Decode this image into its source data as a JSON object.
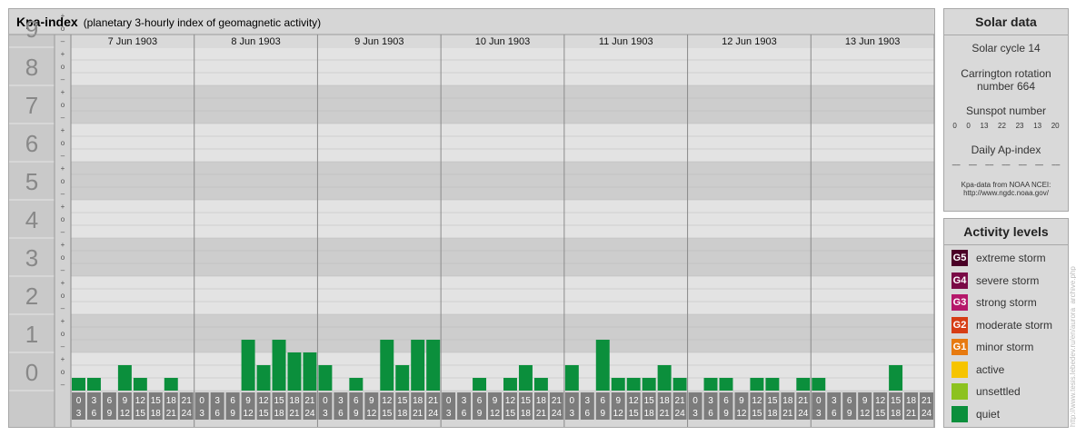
{
  "header": {
    "title": "Kpa-index",
    "subtitle": "(planetary 3-hourly index of geomagnetic activity)"
  },
  "chart_data": {
    "type": "bar",
    "ylim": [
      0,
      9
    ],
    "y_ticks": [
      "0",
      "1",
      "2",
      "3",
      "4",
      "5",
      "6",
      "7",
      "8",
      "9"
    ],
    "sub_ticks": [
      "+",
      "o",
      "–"
    ],
    "days": [
      "7 Jun 1903",
      "8 Jun 1903",
      "9 Jun 1903",
      "10 Jun 1903",
      "11 Jun 1903",
      "12 Jun 1903",
      "13 Jun 1903"
    ],
    "hour_start_labels": [
      "0",
      "3",
      "6",
      "9",
      "12",
      "15",
      "18",
      "21"
    ],
    "hour_end_labels": [
      "3",
      "6",
      "9",
      "12",
      "15",
      "18",
      "21",
      "24"
    ],
    "values": [
      [
        0.333,
        0.333,
        0,
        0.667,
        0.333,
        0,
        0.333,
        0
      ],
      [
        0,
        0,
        0,
        1.333,
        0.667,
        1.333,
        1,
        1
      ],
      [
        0.667,
        0,
        0.333,
        0,
        1.333,
        0.667,
        1.333,
        1.333
      ],
      [
        0,
        0,
        0.333,
        0,
        0.333,
        0.667,
        0.333,
        0
      ],
      [
        0.667,
        0,
        1.333,
        0.333,
        0.333,
        0.333,
        0.667,
        0.333
      ],
      [
        0,
        0.333,
        0.333,
        0,
        0.333,
        0.333,
        0,
        0.333
      ],
      [
        0.333,
        0,
        0,
        0,
        0,
        0.667,
        0,
        0
      ]
    ],
    "bar_color": "#0b8f3c"
  },
  "solar": {
    "title": "Solar data",
    "cycle": "Solar cycle 14",
    "carrington_line1": "Carrington rotation",
    "carrington_line2": "number 664",
    "sunspot_title": "Sunspot number",
    "sunspots": [
      "0",
      "0",
      "13",
      "22",
      "23",
      "13",
      "20"
    ],
    "ap_title": "Daily Ap-index",
    "ap_values": [
      "––",
      "––",
      "––",
      "––",
      "––",
      "––",
      "––"
    ],
    "source_line1": "Kpa-data from NOAA NCEI:",
    "source_line2": "http://www.ngdc.noaa.gov/"
  },
  "levels": {
    "title": "Activity levels",
    "items": [
      {
        "badge": "G5",
        "label": "extreme storm",
        "color": "#4a0026"
      },
      {
        "badge": "G4",
        "label": "severe storm",
        "color": "#7a0a46"
      },
      {
        "badge": "G3",
        "label": "strong storm",
        "color": "#b5186a"
      },
      {
        "badge": "G2",
        "label": "moderate storm",
        "color": "#d63d14"
      },
      {
        "badge": "G1",
        "label": "minor storm",
        "color": "#e77a10"
      },
      {
        "badge": "",
        "label": "active",
        "color": "#f6c400"
      },
      {
        "badge": "",
        "label": "unsettled",
        "color": "#8cc21f"
      },
      {
        "badge": "",
        "label": "quiet",
        "color": "#0b8f3c"
      }
    ]
  },
  "watermark": "http://www.tesis.lebedev.ru/en/aurora_archive.php"
}
